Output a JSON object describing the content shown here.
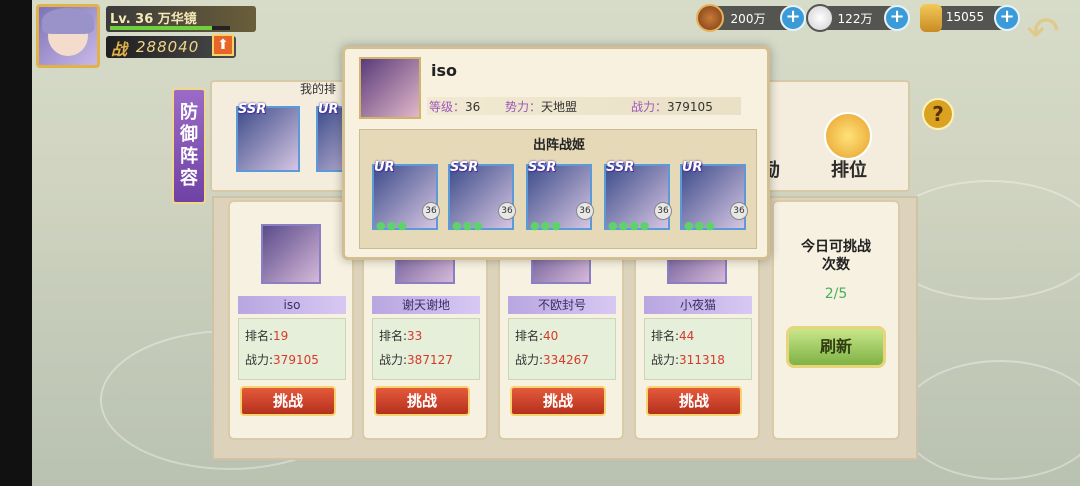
{
  "player": {
    "level_text": "Lv. 36 万华镜",
    "power_icon": "战",
    "power": "288040",
    "exp_fraction": 0.85
  },
  "currencies": [
    {
      "icon": "coin-icon",
      "value": "200万"
    },
    {
      "icon": "rice-ball-icon",
      "value": "122万"
    },
    {
      "icon": "scroll-icon",
      "value": "15055"
    }
  ],
  "defense_tab": {
    "label": "防御阵容"
  },
  "lineup": {
    "title": "我的排",
    "heroes": [
      {
        "rank": "SSR"
      },
      {
        "rank": "UR"
      }
    ]
  },
  "side_buttons": {
    "reward_label": "励",
    "rank_label": "排位",
    "help": "?"
  },
  "opponents": [
    {
      "name": "iso",
      "rank_label": "排名:",
      "rank": "19",
      "power_label": "战力:",
      "power": "379105",
      "button": "挑战"
    },
    {
      "name": "谢天谢地",
      "rank_label": "排名:",
      "rank": "33",
      "power_label": "战力:",
      "power": "387127",
      "button": "挑战"
    },
    {
      "name": "不欧封号",
      "rank_label": "排名:",
      "rank": "40",
      "power_label": "战力:",
      "power": "334267",
      "button": "挑战"
    },
    {
      "name": "小夜猫",
      "rank_label": "排名:",
      "rank": "44",
      "power_label": "战力:",
      "power": "311318",
      "button": "挑战"
    }
  ],
  "challenge_info": {
    "title": "今日可挑战次数",
    "count": "2/5",
    "refresh": "刷新"
  },
  "popup": {
    "name": "iso",
    "level_label": "等级：",
    "level": "36",
    "faction_label": "势力：",
    "faction": "天地盟",
    "power_label": "战力：",
    "power": "379105",
    "section_title": "出阵战姬",
    "heroes": [
      {
        "rank": "UR",
        "level": "36",
        "stars": "●●●"
      },
      {
        "rank": "SSR",
        "level": "36",
        "stars": "●●●"
      },
      {
        "rank": "SSR",
        "level": "36",
        "stars": "●●●"
      },
      {
        "rank": "SSR",
        "level": "36",
        "stars": "●●●●"
      },
      {
        "rank": "UR",
        "level": "36",
        "stars": "●●●"
      }
    ]
  }
}
